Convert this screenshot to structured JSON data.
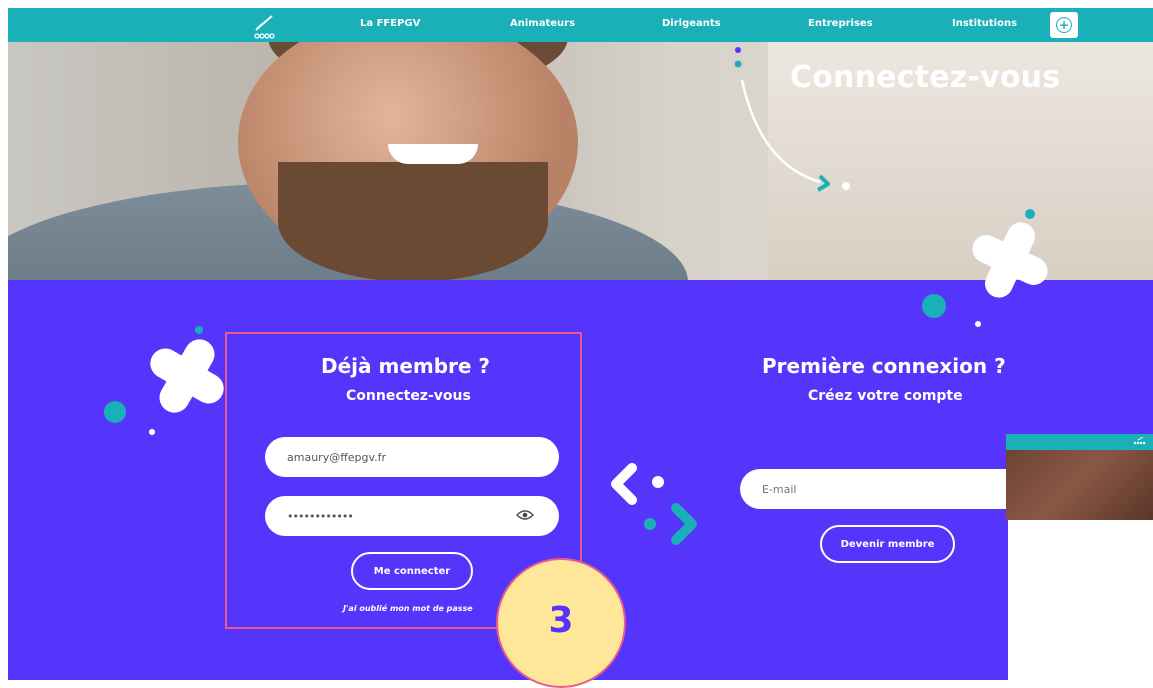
{
  "nav": {
    "items": [
      "La FFEPGV",
      "Animateurs",
      "Dirigeants",
      "Entreprises",
      "Institutions"
    ],
    "plus_symbol": "+"
  },
  "hero": {
    "title": "Connectez-vous"
  },
  "login": {
    "heading": "Déjà membre ?",
    "subheading": "Connectez-vous",
    "email_value": "amaury@ffepgv.fr",
    "password_value": "••••••••••••",
    "submit_label": "Me connecter",
    "forgot_label": "J'ai oublié mon mot de passe"
  },
  "signup": {
    "heading": "Première connexion ?",
    "subheading": "Créez votre compte",
    "email_placeholder": "E-mail",
    "submit_label": "Devenir membre"
  },
  "annotation": {
    "step_number": "3"
  },
  "colors": {
    "teal": "#19b0b8",
    "purple": "#5535fb",
    "highlight": "#e95a8a",
    "badge_fill": "#ffe79a"
  },
  "icons": [
    "logo-icon",
    "plus-circle-icon",
    "eye-icon",
    "cross-decoration-icon",
    "arrow-decoration-icon"
  ]
}
